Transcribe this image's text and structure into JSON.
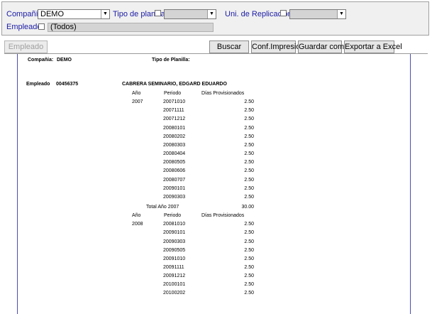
{
  "filters": {
    "compania_label": "Compañía",
    "compania_value": "DEMO",
    "tipo_planilla_label": "Tipo de planilla",
    "uni_replicacion_label": "Uni. de Replicación",
    "empleado_label": "Empleado",
    "empleado_value": "(Todos)"
  },
  "toolbar": {
    "empleado": "Empleado",
    "buscar": "Buscar",
    "conf_impresion": "Conf.Impresión",
    "guardar_como": "Guardar como",
    "exportar_excel": "Exportar a Excel"
  },
  "report": {
    "compania_label": "Compañía:",
    "compania_value": "DEMO",
    "tipo_planilla_label": "Tipo de Planilla:",
    "empleado_label": "Empleado",
    "empleado_code": "00456375",
    "empleado_name": "CABRERA SEMINARIO, EDGARD EDUARDO",
    "col_anio": "Año",
    "col_periodo": "Periodo",
    "col_dias": "Días Provisionados",
    "groups": [
      {
        "year": "2007",
        "rows": [
          {
            "periodo": "20071010",
            "dias": "2.50"
          },
          {
            "periodo": "20071111",
            "dias": "2.50"
          },
          {
            "periodo": "20071212",
            "dias": "2.50"
          },
          {
            "periodo": "20080101",
            "dias": "2.50"
          },
          {
            "periodo": "20080202",
            "dias": "2.50"
          },
          {
            "periodo": "20080303",
            "dias": "2.50"
          },
          {
            "periodo": "20080404",
            "dias": "2.50"
          },
          {
            "periodo": "20080505",
            "dias": "2.50"
          },
          {
            "periodo": "20080606",
            "dias": "2.50"
          },
          {
            "periodo": "20080707",
            "dias": "2.50"
          },
          {
            "periodo": "20090101",
            "dias": "2.50"
          },
          {
            "periodo": "20090303",
            "dias": "2.50"
          }
        ],
        "total_label": "Total Año 2007",
        "total": "30.00"
      },
      {
        "year": "2008",
        "rows": [
          {
            "periodo": "20081010",
            "dias": "2.50"
          },
          {
            "periodo": "20090101",
            "dias": "2.50"
          },
          {
            "periodo": "20090303",
            "dias": "2.50"
          },
          {
            "periodo": "20090505",
            "dias": "2.50"
          },
          {
            "periodo": "20091010",
            "dias": "2.50"
          },
          {
            "periodo": "20091111",
            "dias": "2.50"
          },
          {
            "periodo": "20091212",
            "dias": "2.50"
          },
          {
            "periodo": "20100101",
            "dias": "2.50"
          },
          {
            "periodo": "20100202",
            "dias": "2.50"
          }
        ]
      }
    ]
  }
}
